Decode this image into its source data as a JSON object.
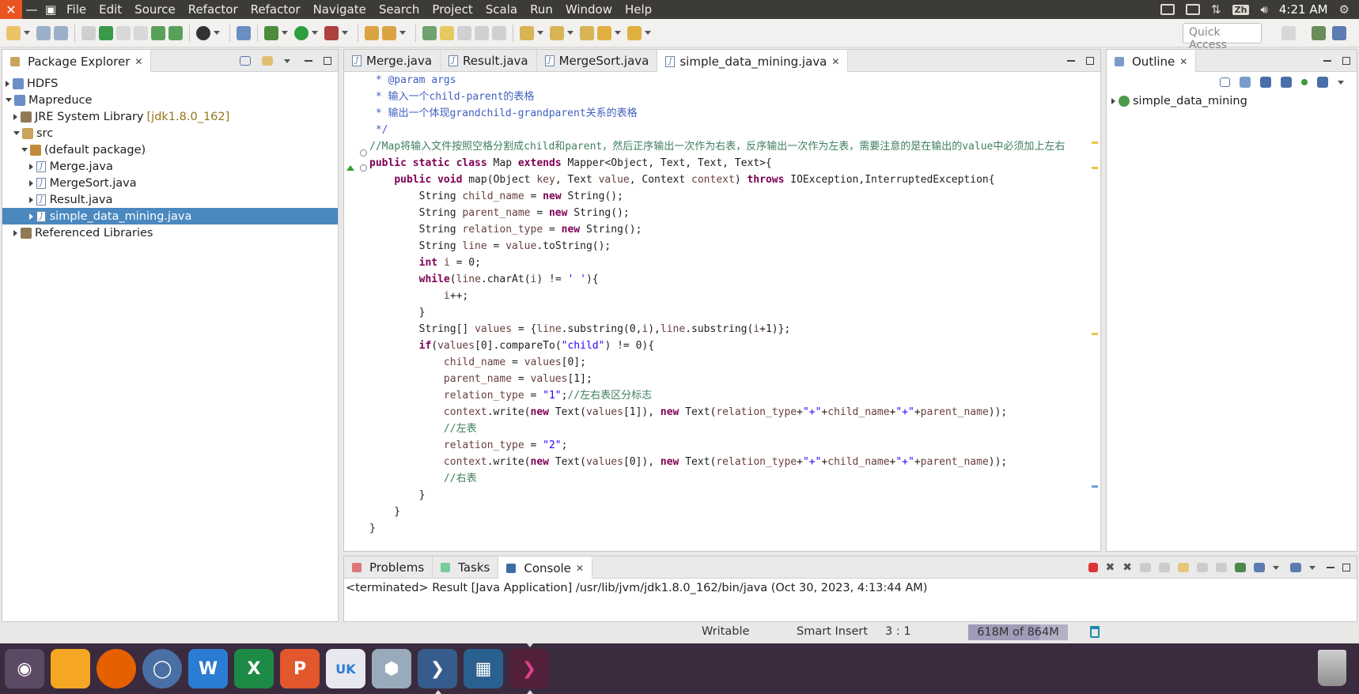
{
  "menubar": {
    "items": [
      "File",
      "Edit",
      "Source",
      "Refactor",
      "Refactor",
      "Navigate",
      "Search",
      "Project",
      "Scala",
      "Run",
      "Window",
      "Help"
    ],
    "tray": {
      "ime": "Zh",
      "clock": "4:21 AM"
    }
  },
  "toolbar": {
    "quick_access": "Quick Access"
  },
  "package_explorer": {
    "title": "Package Explorer",
    "tree": {
      "hdfs": "HDFS",
      "mapreduce": "Mapreduce",
      "jre": "JRE System Library",
      "jre_version": "[jdk1.8.0_162]",
      "src": "src",
      "default_pkg": "(default package)",
      "files": [
        "Merge.java",
        "MergeSort.java",
        "Result.java",
        "simple_data_mining.java"
      ],
      "ref_libs": "Referenced Libraries"
    }
  },
  "editor": {
    "tabs": [
      "Merge.java",
      "Result.java",
      "MergeSort.java",
      "simple_data_mining.java"
    ],
    "code": {
      "l0": " * @param args",
      "l1": " * 输入一个child-parent的表格",
      "l2": " * 输出一个体现grandchild-grandparent关系的表格",
      "l3": " */",
      "l4": "//Map将输入文件按照空格分割成child和parent，然后正序输出一次作为右表，反序输出一次作为左表，需要注意的是在输出的value中必须加上左右",
      "l20": "//左右表区分标志",
      "l22": "//左表",
      "l25": "//右表"
    }
  },
  "outline": {
    "title": "Outline",
    "item": "simple_data_mining"
  },
  "console": {
    "tabs": [
      "Problems",
      "Tasks",
      "Console"
    ],
    "terminated": "<terminated> Result [Java Application] /usr/lib/jvm/jdk1.8.0_162/bin/java (Oct 30, 2023, 4:13:44 AM)"
  },
  "statusbar": {
    "writable": "Writable",
    "insert_mode": "Smart Insert",
    "position": "3 : 1",
    "heap": "618M of 864M",
    "heap_used_fraction": 0.715
  },
  "dock": {
    "apps": [
      "ubuntu-icon",
      "files-icon",
      "firefox-icon",
      "chromium-icon",
      "word-icon",
      "excel-icon",
      "powerpoint-icon",
      "ukui-icon",
      "installer-icon",
      "vscode-icon",
      "terminal-grid-icon",
      "eclipse-icon"
    ],
    "colors": {
      "files": "#f5a623",
      "firefox": "#e66000",
      "word": "#2b7cd3",
      "excel": "#1d8a45",
      "ppt": "#e2572c"
    }
  }
}
